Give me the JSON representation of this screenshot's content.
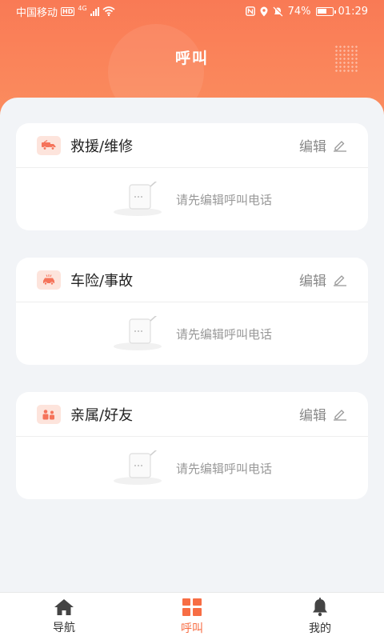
{
  "status": {
    "carrier": "中国移动",
    "hd": "HD",
    "network": "4G",
    "battery_percent": "74%",
    "battery_level": 0.74,
    "time": "01:29"
  },
  "header": {
    "title": "呼叫"
  },
  "cards": [
    {
      "title": "救援/维修",
      "icon": "tow-truck-icon",
      "edit_label": "编辑",
      "empty_text": "请先编辑呼叫电话"
    },
    {
      "title": "车险/事故",
      "icon": "car-accident-icon",
      "edit_label": "编辑",
      "empty_text": "请先编辑呼叫电话"
    },
    {
      "title": "亲属/好友",
      "icon": "family-icon",
      "edit_label": "编辑",
      "empty_text": "请先编辑呼叫电话"
    }
  ],
  "tabbar": {
    "items": [
      {
        "label": "导航",
        "icon": "home-icon",
        "active": false
      },
      {
        "label": "呼叫",
        "icon": "grid-icon",
        "active": true
      },
      {
        "label": "我的",
        "icon": "bell-icon",
        "active": false
      }
    ]
  },
  "colors": {
    "accent": "#f76d44",
    "header_top": "#f97a55",
    "header_bottom": "#fb8d5f",
    "background": "#f2f4f7"
  }
}
